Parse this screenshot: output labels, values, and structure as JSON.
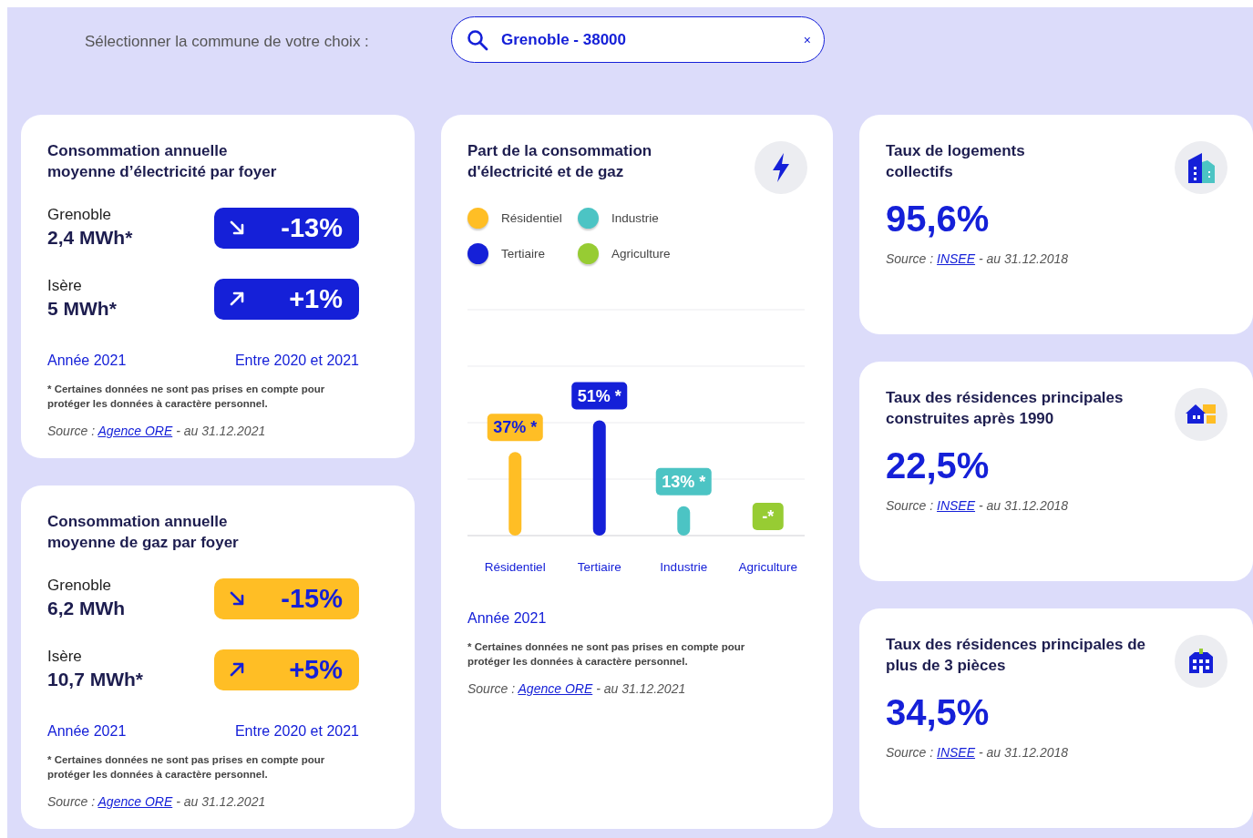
{
  "search": {
    "label": "Sélectionner la commune de votre choix :",
    "value": "Grenoble - 38000",
    "clear": "×"
  },
  "consumption_cards": [
    {
      "kind": "electricity",
      "title": "Consommation annuelle\nmoyenne d’électricité par foyer",
      "rows": [
        {
          "place": "Grenoble",
          "amount": "2,4 MWh*",
          "increase": false,
          "change": "-13%"
        },
        {
          "place": "Isère",
          "amount": "5 MWh*",
          "increase": true,
          "change": "+1%"
        }
      ],
      "year_label": "Année 2021",
      "period_label": "Entre 2020 et 2021",
      "footnote": "* Certaines données ne sont pas prises en compte pour protéger les données à caractère personnel.",
      "source": {
        "prefix": "Source :",
        "link": "Agence ORE",
        "suffix": "- au 31.12.2021"
      }
    },
    {
      "kind": "gas",
      "title": "Consommation annuelle\nmoyenne de gaz par foyer",
      "rows": [
        {
          "place": "Grenoble",
          "amount": "6,2 MWh",
          "increase": false,
          "change": "-15%"
        },
        {
          "place": "Isère",
          "amount": "10,7 MWh*",
          "increase": true,
          "change": "+5%"
        }
      ],
      "year_label": "Année 2021",
      "period_label": "Entre 2020 et 2021",
      "footnote": "* Certaines données ne sont pas prises en compte pour protéger les données à caractère personnel.",
      "source": {
        "prefix": "Source :",
        "link": "Agence ORE",
        "suffix": "- au 31.12.2021"
      }
    }
  ],
  "share_card": {
    "title": "Part de la consommation\nd'électricité et de gaz",
    "legend": [
      {
        "label": "Résidentiel",
        "color": "#ffbe25"
      },
      {
        "label": "Industrie",
        "color": "#4cc4c4"
      },
      {
        "label": "Tertiaire",
        "color": "#1520d8"
      },
      {
        "label": "Agriculture",
        "color": "#97cc33"
      }
    ],
    "chart_data": {
      "type": "bar",
      "categories": [
        "Résidentiel",
        "Tertiaire",
        "Industrie",
        "Agriculture"
      ],
      "values": [
        37,
        51,
        13,
        null
      ],
      "ylim": [
        0,
        100
      ],
      "value_labels": [
        "37% *",
        "51% *",
        "13% *",
        "-*"
      ]
    },
    "year_label": "Année 2021",
    "footnote": "* Certaines données ne sont pas prises en compte pour protéger les données à caractère personnel.",
    "source": {
      "prefix": "Source :",
      "link": "Agence ORE",
      "suffix": "- au 31.12.2021"
    }
  },
  "rate_cards": [
    {
      "kind": "buildings",
      "title": "Taux de logements\ncollectifs",
      "value": "95,6%",
      "source": {
        "prefix": "Source :",
        "link": "INSEE",
        "suffix": "- au 31.12.2018"
      }
    },
    {
      "kind": "house",
      "title": "Taux des résidences principales\nconstruites après 1990",
      "value": "22,5%",
      "source": {
        "prefix": "Source :",
        "link": "INSEE",
        "suffix": "- au 31.12.2018"
      }
    },
    {
      "kind": "apartment",
      "title": "Taux des résidences principales de\nplus de 3 pièces",
      "value": "34,5%",
      "source": {
        "prefix": "Source :",
        "link": "INSEE",
        "suffix": "- au 31.12.2018"
      }
    }
  ]
}
